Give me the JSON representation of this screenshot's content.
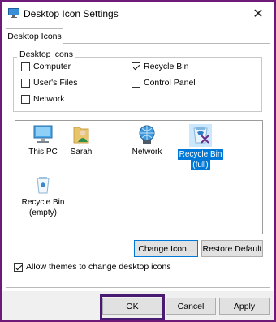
{
  "window": {
    "title": "Desktop Icon Settings",
    "close_glyph": "✕"
  },
  "tab": {
    "label": "Desktop Icons"
  },
  "desktop_icons_group": {
    "label": "Desktop icons",
    "options": [
      {
        "label": "Computer",
        "checked": false
      },
      {
        "label": "User's Files",
        "checked": false
      },
      {
        "label": "Network",
        "checked": false
      },
      {
        "label": "Recycle Bin",
        "checked": true
      },
      {
        "label": "Control Panel",
        "checked": false
      }
    ]
  },
  "icon_list": [
    {
      "label": "This PC",
      "icon": "monitor-icon",
      "selected": false
    },
    {
      "label": "Sarah",
      "icon": "user-folder-icon",
      "selected": false
    },
    {
      "label": "Network",
      "icon": "network-globe-icon",
      "selected": false
    },
    {
      "label": "Recycle Bin (full)",
      "line1": "Recycle Bin",
      "line2": "(full)",
      "icon": "recycle-bin-full-icon",
      "selected": true
    },
    {
      "label": "Recycle Bin (empty)",
      "line1": "Recycle Bin",
      "line2": "(empty)",
      "icon": "recycle-bin-empty-icon",
      "selected": false
    }
  ],
  "buttons": {
    "change_icon": "Change Icon...",
    "restore_default": "Restore Default",
    "ok": "OK",
    "cancel": "Cancel",
    "apply": "Apply"
  },
  "themes_checkbox": {
    "label": "Allow themes to change desktop icons",
    "checked": true
  },
  "colors": {
    "selection": "#0078d7",
    "highlight_frame": "#4a1b73",
    "background": "#6e1a78"
  }
}
